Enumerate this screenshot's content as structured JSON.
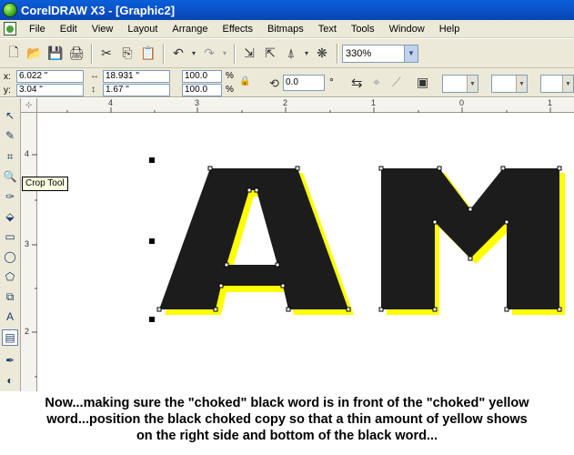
{
  "window": {
    "title": "CorelDRAW X3 - [Graphic2]"
  },
  "menu": {
    "items": [
      "File",
      "Edit",
      "View",
      "Layout",
      "Arrange",
      "Effects",
      "Bitmaps",
      "Text",
      "Tools",
      "Window",
      "Help"
    ]
  },
  "toolbar": {
    "zoom_value": "330%"
  },
  "property_bar": {
    "x_label": "x:",
    "x_value": "6.022 \"",
    "y_label": "y:",
    "y_value": "3.04 \"",
    "width_value": "18.931 \"",
    "height_value": "1.67 \"",
    "scale_w": "100.0",
    "scale_h": "100.0",
    "pct1": "%",
    "pct2": "%",
    "rotation_value": "0.0",
    "degree_symbol": "°"
  },
  "rulers": {
    "horizontal_ticks": [
      "4",
      "3",
      "2",
      "1",
      "0",
      "1"
    ],
    "vertical_ticks": [
      "4",
      "3",
      "2"
    ]
  },
  "tooltip": {
    "text": "Crop Tool"
  },
  "artwork": {
    "letters": "AM",
    "fill_color": "#1c1c1c",
    "shadow_color": "#ffff00"
  },
  "caption": {
    "line1": "Now...making sure the \"choked\" black word is in front of the \"choked\" yellow",
    "line2": "word...position the black choked copy so that a thin amount of yellow shows",
    "line3": "on the right side and bottom of the black word..."
  },
  "colors": {
    "titlebar": "#0a4fc4",
    "chrome": "#ece9d8"
  }
}
